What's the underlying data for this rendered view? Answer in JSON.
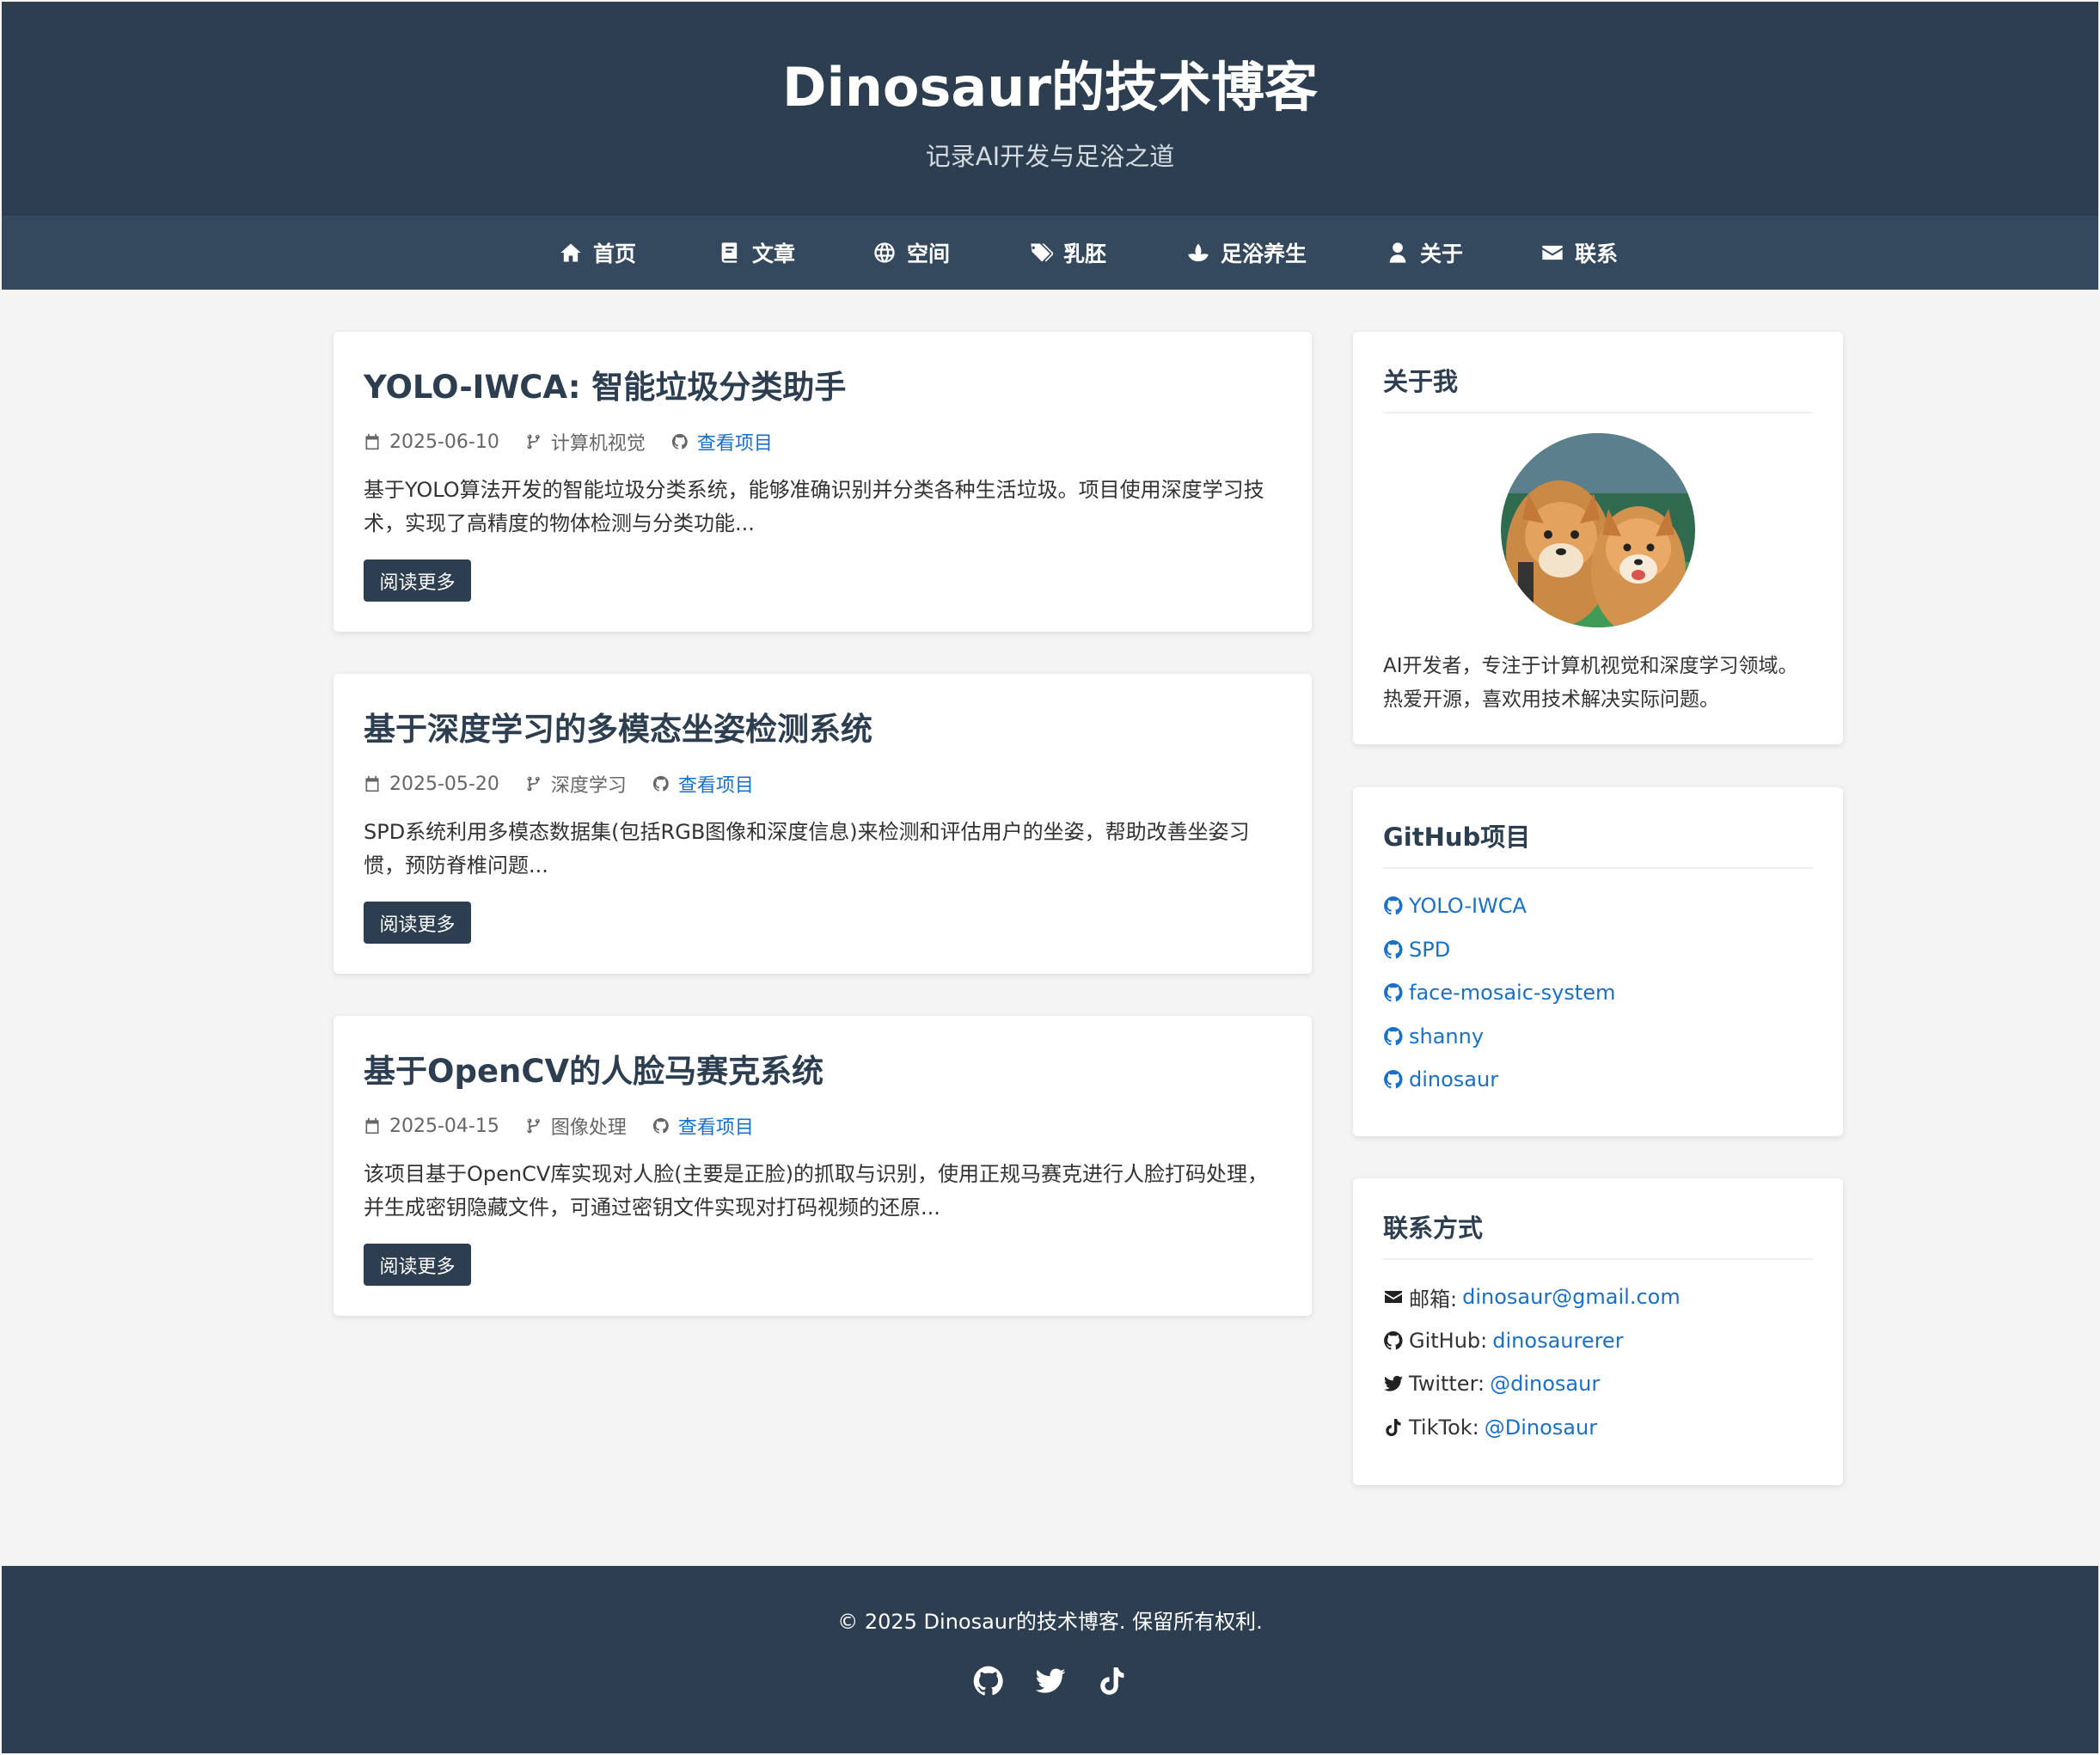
{
  "header": {
    "title": "Dinosaur的技术博客",
    "subtitle": "记录AI开发与足浴之道"
  },
  "nav": [
    {
      "label": "首页",
      "icon": "home-icon"
    },
    {
      "label": "文章",
      "icon": "book-icon"
    },
    {
      "label": "空间",
      "icon": "globe-icon"
    },
    {
      "label": "乳胚",
      "icon": "tags-icon"
    },
    {
      "label": "足浴养生",
      "icon": "spa-icon"
    },
    {
      "label": "关于",
      "icon": "user-icon"
    },
    {
      "label": "联系",
      "icon": "envelope-icon"
    }
  ],
  "posts": [
    {
      "title": "YOLO-IWCA: 智能垃圾分类助手",
      "date": "2025-06-10",
      "category": "计算机视觉",
      "link": "查看项目",
      "excerpt": "基于YOLO算法开发的智能垃圾分类系统，能够准确识别并分类各种生活垃圾。项目使用深度学习技术，实现了高精度的物体检测与分类功能...",
      "button": "阅读更多"
    },
    {
      "title": "基于深度学习的多模态坐姿检测系统",
      "date": "2025-05-20",
      "category": "深度学习",
      "link": "查看项目",
      "excerpt": "SPD系统利用多模态数据集(包括RGB图像和深度信息)来检测和评估用户的坐姿，帮助改善坐姿习惯，预防脊椎问题...",
      "button": "阅读更多"
    },
    {
      "title": "基于OpenCV的人脸马赛克系统",
      "date": "2025-04-15",
      "category": "图像处理",
      "link": "查看项目",
      "excerpt": "该项目基于OpenCV库实现对人脸(主要是正脸)的抓取与识别，使用正规马赛克进行人脸打码处理，并生成密钥隐藏文件，可通过密钥文件实现对打码视频的还原...",
      "button": "阅读更多"
    }
  ],
  "about": {
    "title": "关于我",
    "text": "AI开发者，专注于计算机视觉和深度学习领域。热爱开源，喜欢用技术解决实际问题。",
    "avatar": "avatar-image"
  },
  "github": {
    "title": "GitHub项目",
    "items": [
      "YOLO-IWCA",
      "SPD",
      "face-mosaic-system",
      "shanny",
      "dinosaur"
    ]
  },
  "contact": {
    "title": "联系方式",
    "items": [
      {
        "label": "邮箱:",
        "value": "dinosaur@gmail.com",
        "icon": "envelope-icon"
      },
      {
        "label": "GitHub:",
        "value": "dinosaurerer",
        "icon": "github-icon"
      },
      {
        "label": "Twitter:",
        "value": "@dinosaur",
        "icon": "twitter-icon"
      },
      {
        "label": "TikTok:",
        "value": "@Dinosaur",
        "icon": "tiktok-icon"
      }
    ]
  },
  "footer": {
    "copyright": "© 2025 Dinosaur的技术博客. 保留所有权利.",
    "icons": [
      "github-icon",
      "twitter-icon",
      "tiktok-icon"
    ]
  },
  "colors": {
    "header_bg": "#2c3e50",
    "nav_bg": "#34495e",
    "link": "#1a6fc7",
    "page_bg": "#f4f4f4"
  }
}
